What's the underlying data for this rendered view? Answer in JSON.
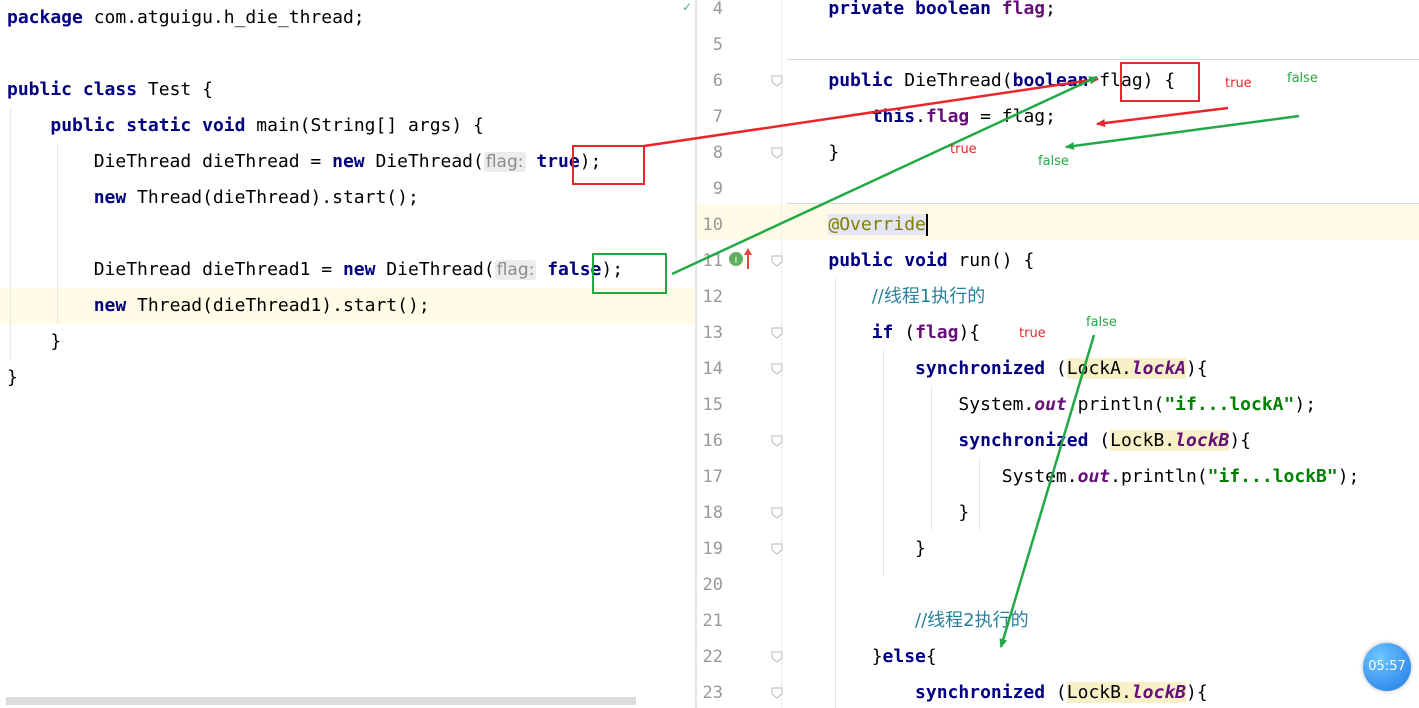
{
  "left_editor": {
    "lines": [
      {
        "parts": [
          {
            "t": "package",
            "c": "kw"
          },
          {
            "t": " com.atguigu.h_die_thread;",
            "c": ""
          }
        ]
      },
      {
        "parts": []
      },
      {
        "parts": [
          {
            "t": "public",
            "c": "kw"
          },
          {
            "t": " ",
            "c": ""
          },
          {
            "t": "class",
            "c": "kw"
          },
          {
            "t": " Test {",
            "c": ""
          }
        ]
      },
      {
        "parts": [
          {
            "t": "    ",
            "c": ""
          },
          {
            "t": "public",
            "c": "kw"
          },
          {
            "t": " ",
            "c": ""
          },
          {
            "t": "static",
            "c": "kw"
          },
          {
            "t": " ",
            "c": ""
          },
          {
            "t": "void",
            "c": "kw"
          },
          {
            "t": " main(String[] args) {",
            "c": ""
          }
        ]
      },
      {
        "parts": [
          {
            "t": "        DieThread dieThread = ",
            "c": ""
          },
          {
            "t": "new",
            "c": "kw"
          },
          {
            "t": " DieThread(",
            "c": ""
          },
          {
            "t": "flag:",
            "c": "hint"
          },
          {
            "t": " ",
            "c": ""
          },
          {
            "t": "true",
            "c": "kw"
          },
          {
            "t": ");",
            "c": ""
          }
        ]
      },
      {
        "parts": [
          {
            "t": "        ",
            "c": ""
          },
          {
            "t": "new",
            "c": "kw"
          },
          {
            "t": " Thread(dieThread).start();",
            "c": ""
          }
        ]
      },
      {
        "parts": []
      },
      {
        "parts": [
          {
            "t": "        DieThread dieThread1 = ",
            "c": ""
          },
          {
            "t": "new",
            "c": "kw"
          },
          {
            "t": " DieThread(",
            "c": ""
          },
          {
            "t": "flag:",
            "c": "hint"
          },
          {
            "t": " ",
            "c": ""
          },
          {
            "t": "false",
            "c": "kw"
          },
          {
            "t": ");",
            "c": ""
          }
        ]
      },
      {
        "parts": [
          {
            "t": "        ",
            "c": ""
          },
          {
            "t": "new",
            "c": "kw"
          },
          {
            "t": " Thread(dieThread1).start();",
            "c": ""
          }
        ]
      },
      {
        "parts": [
          {
            "t": "    }",
            "c": ""
          }
        ]
      },
      {
        "parts": [
          {
            "t": "}",
            "c": ""
          }
        ]
      }
    ]
  },
  "right_editor": {
    "lines": [
      {
        "num": "4",
        "parts": [
          {
            "t": "    ",
            "c": ""
          },
          {
            "t": "private",
            "c": "kw"
          },
          {
            "t": " ",
            "c": ""
          },
          {
            "t": "boolean",
            "c": "kw"
          },
          {
            "t": " ",
            "c": ""
          },
          {
            "t": "flag",
            "c": "field"
          },
          {
            "t": ";",
            "c": ""
          }
        ]
      },
      {
        "num": "5",
        "parts": []
      },
      {
        "num": "6",
        "parts": [
          {
            "t": "    ",
            "c": ""
          },
          {
            "t": "public",
            "c": "kw"
          },
          {
            "t": " DieThread(",
            "c": ""
          },
          {
            "t": "boolean",
            "c": "kw"
          },
          {
            "t": " flag) {",
            "c": ""
          }
        ]
      },
      {
        "num": "7",
        "parts": [
          {
            "t": "        ",
            "c": ""
          },
          {
            "t": "this",
            "c": "kw"
          },
          {
            "t": ".",
            "c": ""
          },
          {
            "t": "flag",
            "c": "field"
          },
          {
            "t": " = flag;",
            "c": ""
          }
        ]
      },
      {
        "num": "8",
        "parts": [
          {
            "t": "    }",
            "c": ""
          }
        ]
      },
      {
        "num": "9",
        "parts": []
      },
      {
        "num": "10",
        "parts": [
          {
            "t": "    ",
            "c": ""
          },
          {
            "t": "@Override",
            "c": "ann hl-over"
          }
        ]
      },
      {
        "num": "11",
        "parts": [
          {
            "t": "    ",
            "c": ""
          },
          {
            "t": "public",
            "c": "kw"
          },
          {
            "t": " ",
            "c": ""
          },
          {
            "t": "void",
            "c": "kw"
          },
          {
            "t": " run() {",
            "c": ""
          }
        ]
      },
      {
        "num": "12",
        "parts": [
          {
            "t": "        ",
            "c": ""
          },
          {
            "t": "//线程1执行的",
            "c": "comment"
          }
        ]
      },
      {
        "num": "13",
        "parts": [
          {
            "t": "        ",
            "c": ""
          },
          {
            "t": "if",
            "c": "kw"
          },
          {
            "t": " (",
            "c": ""
          },
          {
            "t": "flag",
            "c": "field"
          },
          {
            "t": "){",
            "c": ""
          }
        ]
      },
      {
        "num": "14",
        "parts": [
          {
            "t": "            ",
            "c": ""
          },
          {
            "t": "synchronized",
            "c": "kw"
          },
          {
            "t": " (",
            "c": ""
          },
          {
            "t": "LockA.",
            "c": "hl"
          },
          {
            "t": "lockA",
            "c": "static hl"
          },
          {
            "t": "){",
            "c": ""
          }
        ]
      },
      {
        "num": "15",
        "parts": [
          {
            "t": "                System.",
            "c": ""
          },
          {
            "t": "out",
            "c": "static"
          },
          {
            "t": ".println(",
            "c": ""
          },
          {
            "t": "\"if...lockA\"",
            "c": "str"
          },
          {
            "t": ");",
            "c": ""
          }
        ]
      },
      {
        "num": "16",
        "parts": [
          {
            "t": "                ",
            "c": ""
          },
          {
            "t": "synchronized",
            "c": "kw"
          },
          {
            "t": " (",
            "c": ""
          },
          {
            "t": "LockB.",
            "c": "hl"
          },
          {
            "t": "lockB",
            "c": "static hl"
          },
          {
            "t": "){",
            "c": ""
          }
        ]
      },
      {
        "num": "17",
        "parts": [
          {
            "t": "                    System.",
            "c": ""
          },
          {
            "t": "out",
            "c": "static"
          },
          {
            "t": ".println(",
            "c": ""
          },
          {
            "t": "\"if...lockB\"",
            "c": "str"
          },
          {
            "t": ");",
            "c": ""
          }
        ]
      },
      {
        "num": "18",
        "parts": [
          {
            "t": "                }",
            "c": ""
          }
        ]
      },
      {
        "num": "19",
        "parts": [
          {
            "t": "            }",
            "c": ""
          }
        ]
      },
      {
        "num": "20",
        "parts": []
      },
      {
        "num": "21",
        "parts": [
          {
            "t": "            ",
            "c": ""
          },
          {
            "t": "//线程2执行的",
            "c": "comment"
          }
        ]
      },
      {
        "num": "22",
        "parts": [
          {
            "t": "        }",
            "c": ""
          },
          {
            "t": "else",
            "c": "kw"
          },
          {
            "t": "{",
            "c": ""
          }
        ]
      },
      {
        "num": "23",
        "parts": [
          {
            "t": "            ",
            "c": ""
          },
          {
            "t": "synchronized",
            "c": "kw"
          },
          {
            "t": " (",
            "c": ""
          },
          {
            "t": "LockB.",
            "c": "hl"
          },
          {
            "t": "lockB",
            "c": "static hl"
          },
          {
            "t": "){",
            "c": ""
          }
        ]
      }
    ]
  },
  "annotations": {
    "true_1": "true",
    "false_1": "false",
    "true_2": "true",
    "false_2": "false",
    "true_3": "true",
    "false_3": "false"
  },
  "timer": {
    "label": "05:57"
  },
  "colors": {
    "red_arrow": "#e8262b",
    "green_arrow": "#21a946",
    "current_line": "#fffbe6",
    "lock_highlight": "#f8f0c6"
  }
}
